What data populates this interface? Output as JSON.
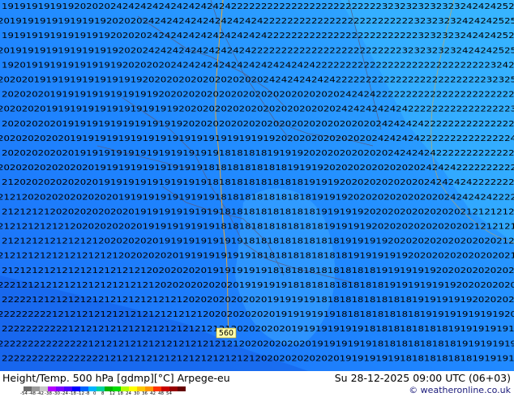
{
  "map": {
    "label_field": "Height/Temp. 500 hPa",
    "contour_560_label": "560",
    "colors": {
      "ocean_dark": "#1c78ff",
      "ocean_light": "#2ea6ff",
      "contour": "#f5a623",
      "border": "#5a5a7a",
      "label_box": "#ffffaa"
    },
    "label_rows": [
      "19191919191920202024242424242424242424222222222222222222222222232323232323232424242525",
      "20191919191919191920202024242424242424242424222222222222222222222222232323232424242525",
      "19191919191919191920202024242424242424242424222222222222222222222222232323232424242525",
      "20191919191919191919202024242424242424242422222222222222222222222223232323232424242525",
      "19201919191919191919202020202424242424242424242424242222222222222222222222222222232424",
      "20202019191919191919191920202020202020202020242424242424222222222222222222222222232325",
      "20202020191919191919191919202020202020202020202020202020242424222222222222222222222223",
      "20202020191919191919191919191920202020202020202020202020242424242424222222222222222223",
      "20202020201919191919191919191920202020202020202020202020202020242424242222222222222222",
      "20202020202019191919191919191919191919191919192020202020202020242424242222222222222224",
      "20202020202019191919191919191919191918181818191919202020202020202424242422222222222222",
      "20202020202020201919191919191919191818181818181819191920202020202020202424242222222222",
      "21202020202020201919191919191919191818181818181818191919202020202020202424242422222222",
      "21212020202020202020191919191919191918181818181818181919192020202020202020242424242222",
      "21212121202020202020201919191919191918181818181818181919191920202020202020202121212121",
      "21212121212120202020202019191919191918181818181818181819191919202020202020202021212121",
      "21212121212121212020202020191919191919191818181818181818191919192020202020202020202121",
      "21212121212121212121202020202019191919191918181818181818181919191919202020202020202021",
      "21212121212121212121212120202020201919191919181818181818181818191919191920202020202020",
      "22212121212121212121212121202020202020201919191918181818181818181919191919192020202020",
      "22222121212121212121212121212120202020202020191919191818181818181818191919191920202020",
      "22222222212121212121212121212121212020202020201919191919181818181818181919191919191920",
      "22222222222121212121212121212121212121202020202019191919191918181818181818191919191919",
      "22222222222222212121212121212121212121212020202020201919191919181818181818181919191919",
      "22222222222222222121212121212121212121212120202020202020191919191918181818181819191919"
    ]
  },
  "footer": {
    "title": "Height/Temp. 500 hPa [gdmp][°C] Arpege-eu",
    "valid_time": "Su 28-12-2025 09:00 UTC (06+03)",
    "credit": "© weatheronline.co.uk",
    "scale_ticks": [
      "-54",
      "-48",
      "-42",
      "-38",
      "-30",
      "-24",
      "-18",
      "-12",
      "-8",
      "0",
      "8",
      "12",
      "18",
      "24",
      "30",
      "36",
      "42",
      "48",
      "54"
    ],
    "scale_colors": [
      "#6b6b6b",
      "#9a9a9a",
      "#c8c8c8",
      "#b400ff",
      "#7a00ff",
      "#4a00ff",
      "#0000ff",
      "#0064ff",
      "#00b4ff",
      "#00d2a0",
      "#00b400",
      "#00dc00",
      "#b4ff00",
      "#ffff00",
      "#ffc800",
      "#ff9600",
      "#ff3200",
      "#c80000",
      "#960000",
      "#640000"
    ]
  }
}
